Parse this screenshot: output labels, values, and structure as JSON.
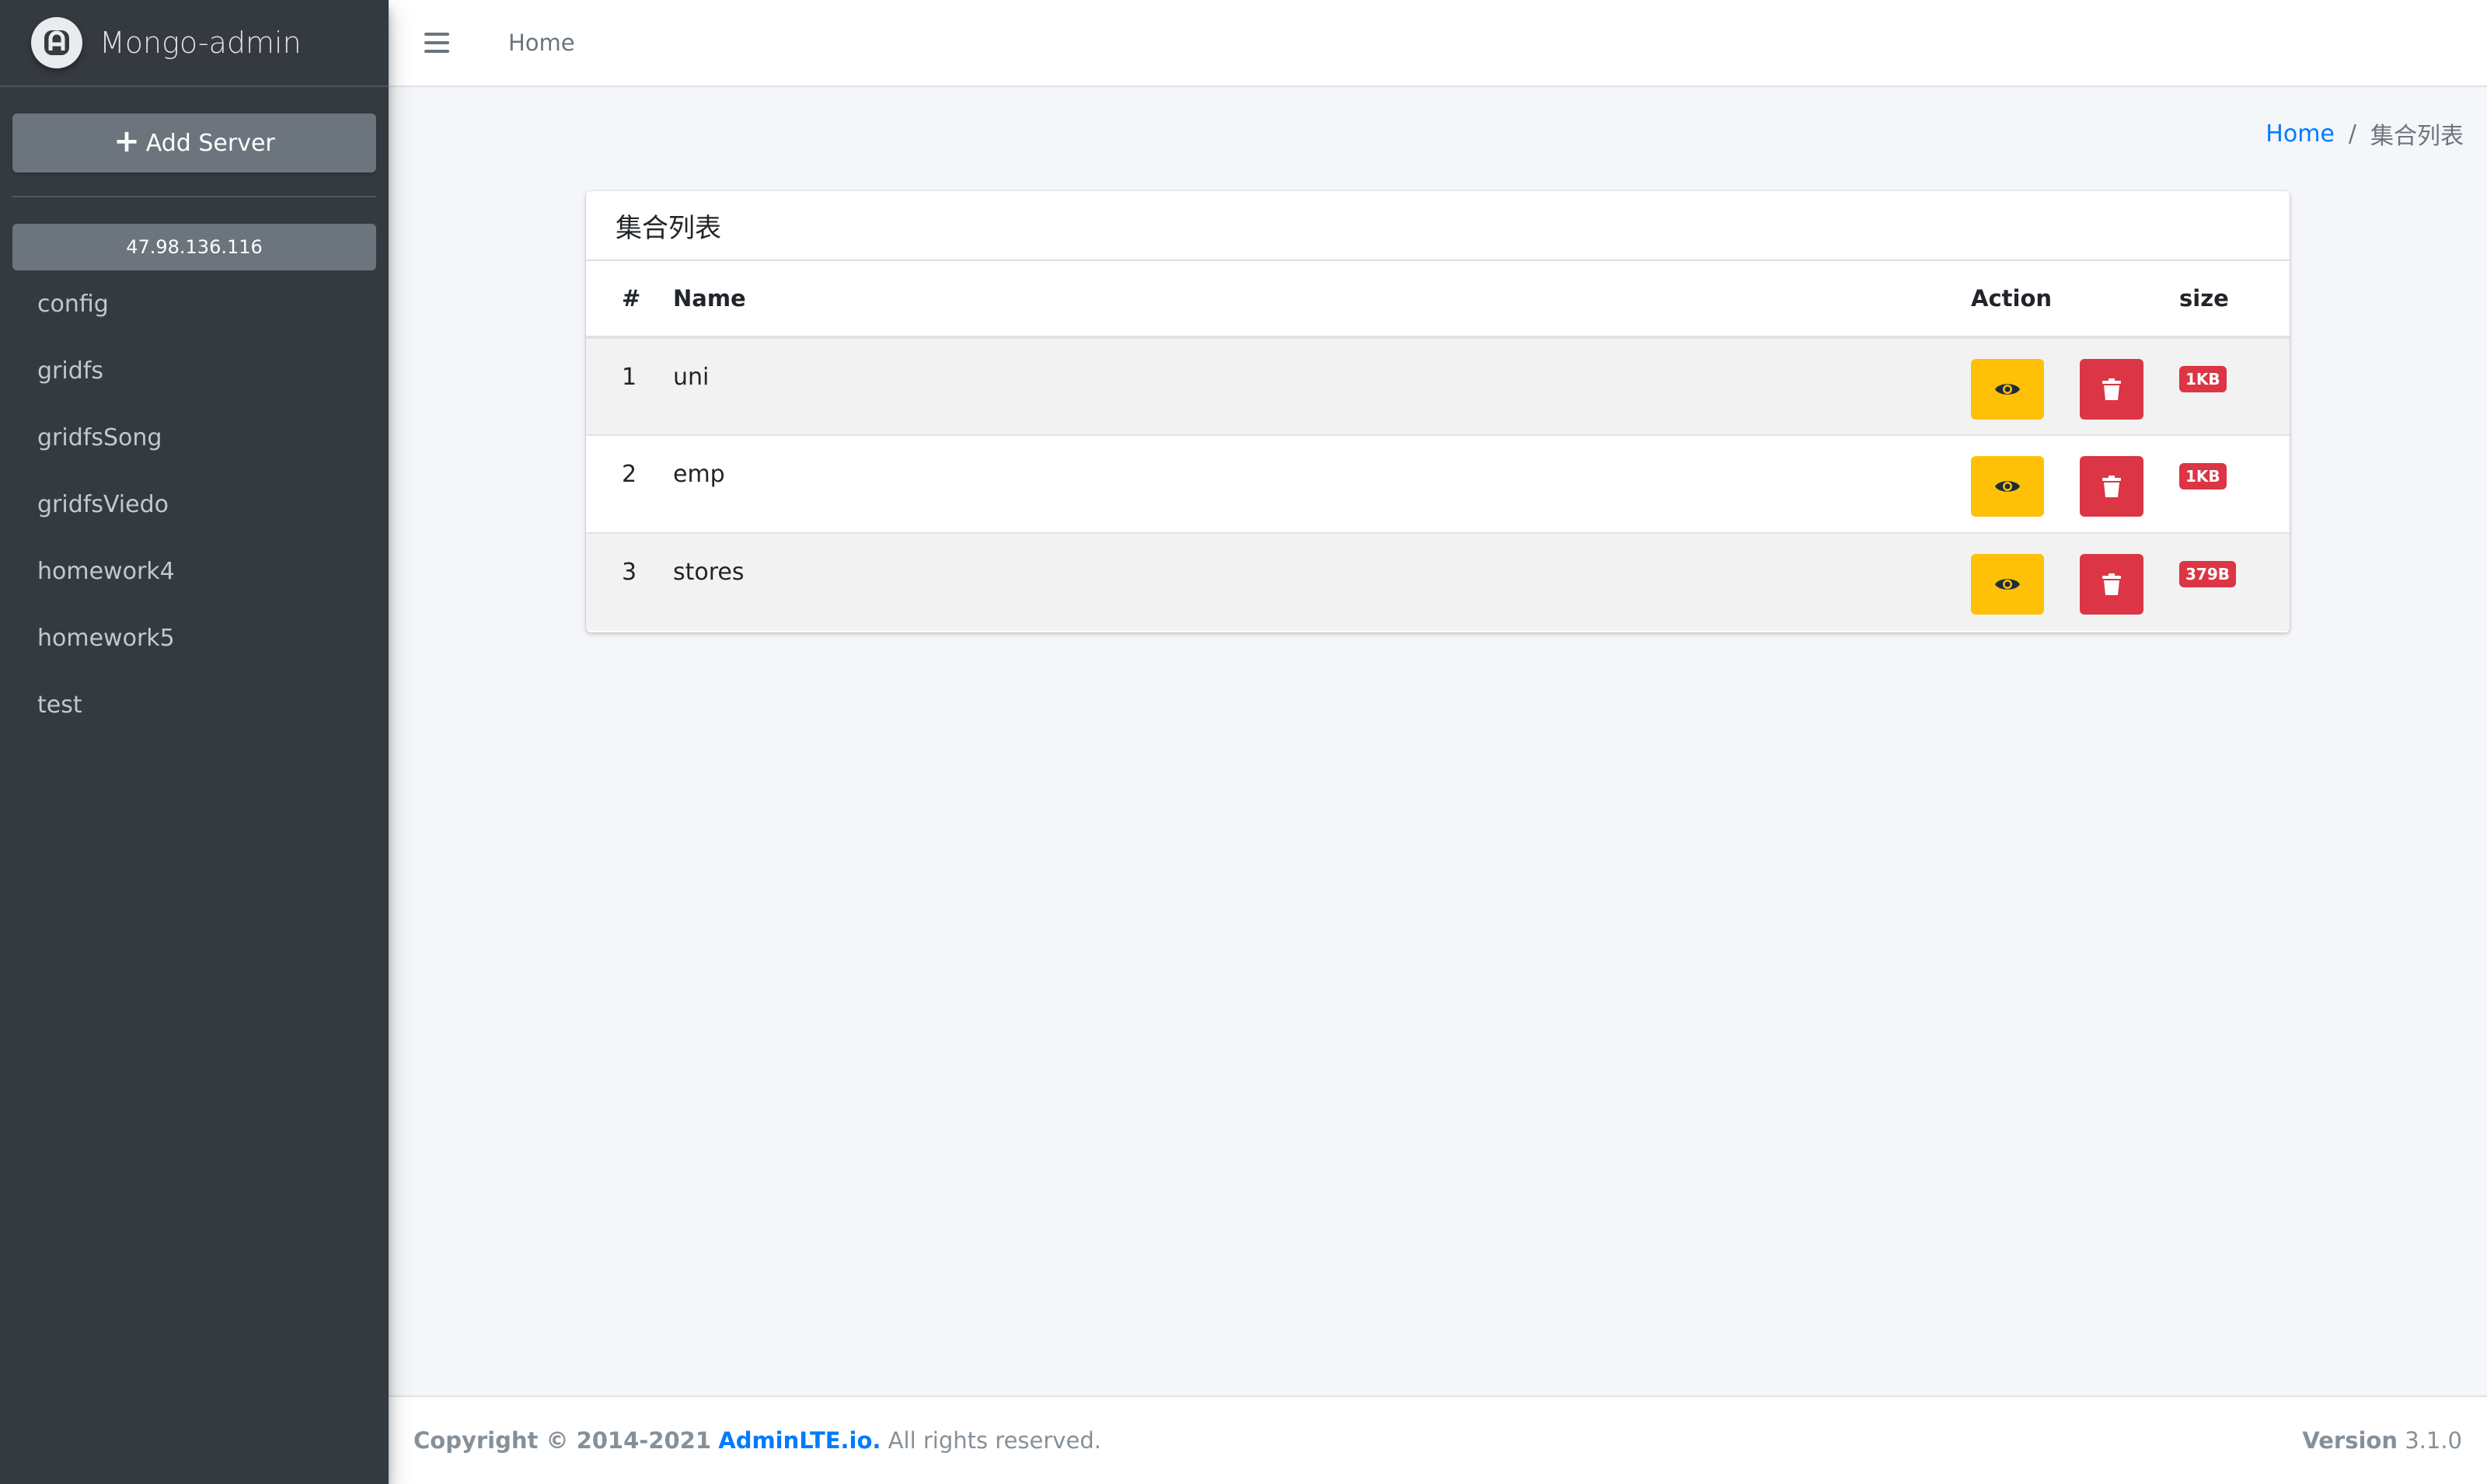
{
  "brand": {
    "title": "Mongo-admin",
    "logo_icon": "mongo-admin-logo-icon"
  },
  "sidebar": {
    "add_server_label": "Add Server",
    "server": "47.98.136.116",
    "databases": [
      "config",
      "gridfs",
      "gridfsSong",
      "gridfsViedo",
      "homework4",
      "homework5",
      "test"
    ]
  },
  "navbar": {
    "home_label": "Home"
  },
  "breadcrumb": {
    "home": "Home",
    "separator": "/",
    "current": "集合列表"
  },
  "card": {
    "title": "集合列表",
    "columns": {
      "num": "#",
      "name": "Name",
      "action": "Action",
      "size": "size"
    },
    "rows": [
      {
        "num": "1",
        "name": "uni",
        "size": "1KB"
      },
      {
        "num": "2",
        "name": "emp",
        "size": "1KB"
      },
      {
        "num": "3",
        "name": "stores",
        "size": "379B"
      }
    ]
  },
  "footer": {
    "copyright": "Copyright © 2014-2021",
    "brand_link": "AdminLTE.io.",
    "rights": "All rights reserved.",
    "version_label": "Version",
    "version": "3.1.0"
  },
  "colors": {
    "sidebar_bg": "#343a40",
    "primary": "#007bff",
    "warning": "#ffc107",
    "danger": "#dc3545",
    "secondary": "#6c757d"
  }
}
